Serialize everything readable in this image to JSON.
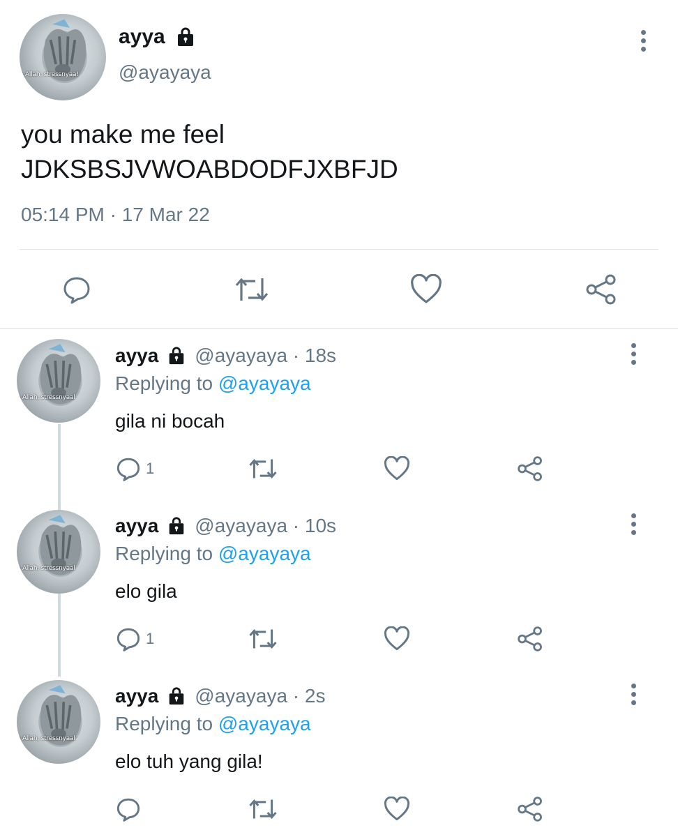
{
  "main_tweet": {
    "name": "ayya",
    "handle": "@ayayaya",
    "text_line1": "you make me feel",
    "text_line2": "JDKSBSJVWOABDODFJXBFJD",
    "timestamp": "05:14 PM · 17 Mar 22",
    "avatar_caption": "a Allah, stressnyaa!",
    "icons": {
      "lock": "lock-icon",
      "more": "more-vertical-icon",
      "reply": "reply-icon",
      "retweet": "retweet-icon",
      "like": "like-icon",
      "share": "share-icon"
    }
  },
  "replies": [
    {
      "name": "ayya",
      "handle_time": "@ayayaya · 18s",
      "replying_prefix": "Replying to ",
      "replying_to": "@ayayaya",
      "text": "gila ni bocah",
      "reply_count": "1",
      "avatar_caption": "a Allah, stressnyaal"
    },
    {
      "name": "ayya",
      "handle_time": "@ayayaya · 10s",
      "replying_prefix": "Replying to ",
      "replying_to": "@ayayaya",
      "text": "elo gila",
      "reply_count": "1",
      "avatar_caption": "a Allah, stressnyaal"
    },
    {
      "name": "ayya",
      "handle_time": "@ayayaya · 2s",
      "replying_prefix": "Replying to ",
      "replying_to": "@ayayaya",
      "text": "elo tuh yang gila!",
      "reply_count": "",
      "avatar_caption": "a Allah, stressnyaal"
    }
  ],
  "colors": {
    "text": "#14171a",
    "secondary": "#657786",
    "mention": "#1da1f2",
    "divider": "#e1e8ed"
  }
}
